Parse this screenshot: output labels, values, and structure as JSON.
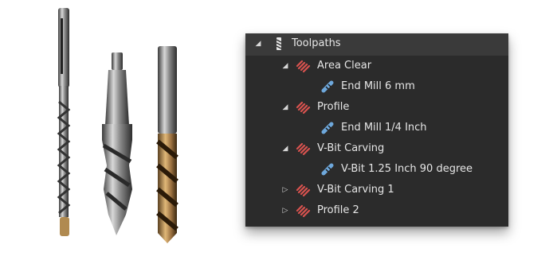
{
  "tree": {
    "root": {
      "label": "Toolpaths",
      "icon": "toolpaths-icon",
      "expanded": true
    },
    "items": [
      {
        "label": "Area Clear",
        "icon": "toolpath-icon",
        "expanded": true,
        "tool": {
          "label": "End Mill 6 mm",
          "icon": "tool-icon"
        }
      },
      {
        "label": "Profile",
        "icon": "toolpath-icon",
        "expanded": true,
        "tool": {
          "label": "End Mill 1/4 Inch",
          "icon": "tool-icon"
        }
      },
      {
        "label": "V-Bit Carving",
        "icon": "toolpath-icon",
        "expanded": true,
        "tool": {
          "label": "V-Bit 1.25 Inch 90 degree",
          "icon": "tool-icon"
        }
      },
      {
        "label": "V-Bit Carving 1",
        "icon": "toolpath-icon",
        "expanded": false
      },
      {
        "label": "Profile 2",
        "icon": "toolpath-icon",
        "expanded": false
      }
    ]
  },
  "colors": {
    "panel_bg": "#2b2b2b",
    "header_bg": "#3a3a3a",
    "text": "#e6e6e6",
    "toolpath_icon": "#d9534f",
    "tool_icon": "#6ea8dc"
  }
}
